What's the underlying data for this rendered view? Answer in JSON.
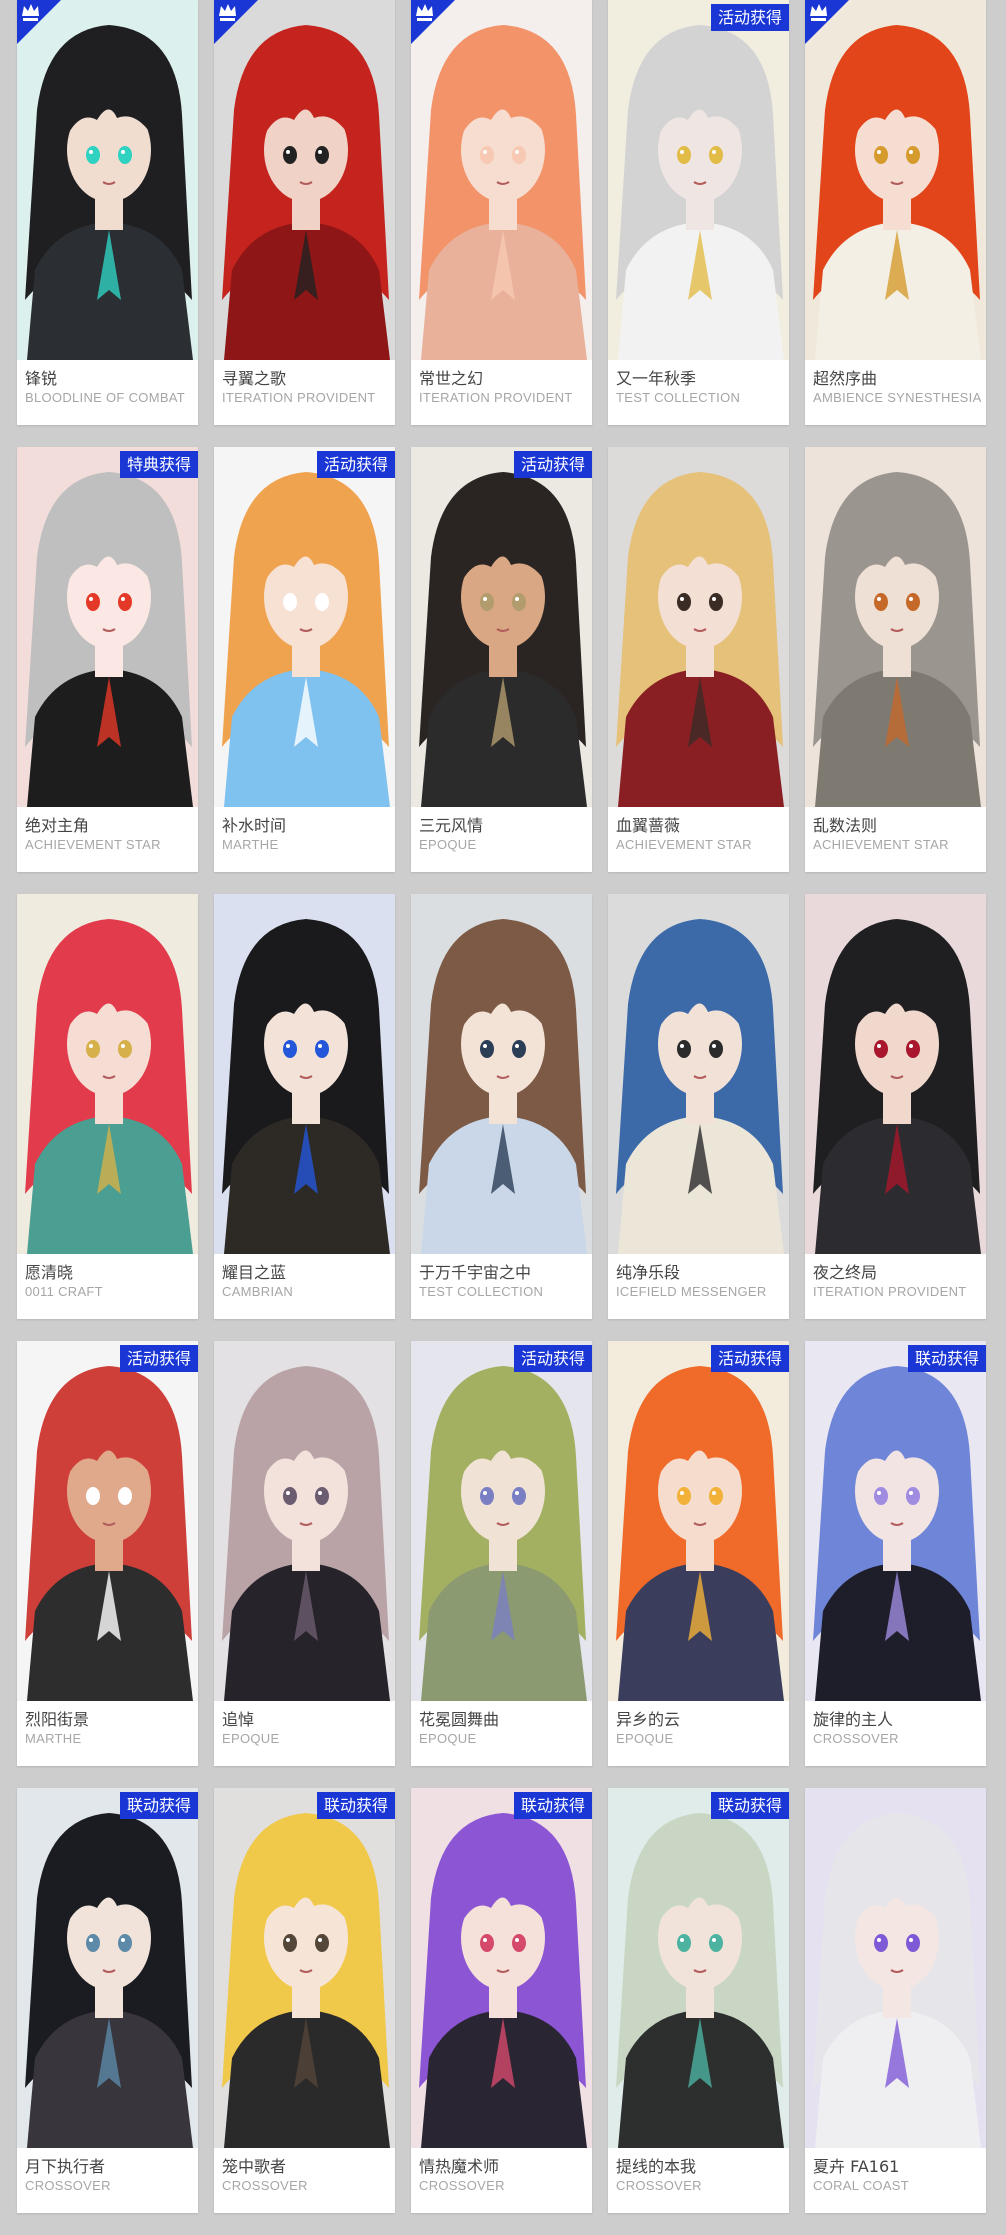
{
  "colors": {
    "badge": "#1a37d6",
    "background": "#cdcdcd",
    "card": "#ffffff"
  },
  "cards": [
    {
      "name": "锋锐",
      "series": "BLOODLINE OF COMBAT",
      "badge": "",
      "crown": true,
      "hair": "#1f1f22",
      "skin": "#f1ddd0",
      "outfit": "#2b2f33",
      "accent": "#2fd2c0"
    },
    {
      "name": "寻翼之歌",
      "series": "ITERATION PROVIDENT",
      "badge": "",
      "crown": true,
      "hair": "#c4231e",
      "skin": "#f0d3c6",
      "outfit": "#8e1616",
      "accent": "#222"
    },
    {
      "name": "常世之幻",
      "series": "ITERATION PROVIDENT",
      "badge": "",
      "crown": true,
      "hair": "#f2936a",
      "skin": "#f6ddcf",
      "outfit": "#e9b09a",
      "accent": "#f7c9b2"
    },
    {
      "name": "又一年秋季",
      "series": "TEST COLLECTION",
      "badge": "活动获得",
      "crown": false,
      "hair": "#d3d3d3",
      "skin": "#efe6e3",
      "outfit": "#f2f2f2",
      "accent": "#e2bc47"
    },
    {
      "name": "超然序曲",
      "series": "AMBIENCE SYNESTHESIA",
      "badge": "",
      "crown": true,
      "hair": "#e2451a",
      "skin": "#f6ddd2",
      "outfit": "#f3efe4",
      "accent": "#d59b2c"
    },
    {
      "name": "绝对主角",
      "series": "ACHIEVEMENT STAR",
      "badge": "特典获得",
      "crown": false,
      "hair": "#bfbfbf",
      "skin": "#fbe7e3",
      "outfit": "#1d1d1d",
      "accent": "#e53928"
    },
    {
      "name": "补水时间",
      "series": "MARTHE",
      "badge": "活动获得",
      "crown": false,
      "hair": "#f0a34f",
      "skin": "#f6e1d2",
      "outfit": "#7fc1ef",
      "accent": "#ffffff"
    },
    {
      "name": "三元风情",
      "series": "EPOQUE",
      "badge": "活动获得",
      "crown": false,
      "hair": "#2a2522",
      "skin": "#d9a783",
      "outfit": "#2b2b2b",
      "accent": "#b29c6e"
    },
    {
      "name": "血翼蔷薇",
      "series": "ACHIEVEMENT STAR",
      "badge": "",
      "crown": false,
      "hair": "#e5c17a",
      "skin": "#f4dfd4",
      "outfit": "#8a1f23",
      "accent": "#3a2b25"
    },
    {
      "name": "乱数法则",
      "series": "ACHIEVEMENT STAR",
      "badge": "",
      "crown": false,
      "hair": "#9a958f",
      "skin": "#efe0d5",
      "outfit": "#7e7a72",
      "accent": "#c4692a"
    },
    {
      "name": "愿清晓",
      "series": "0011 CRAFT",
      "badge": "",
      "crown": false,
      "hair": "#e23c4c",
      "skin": "#f5ddd3",
      "outfit": "#4a9e92",
      "accent": "#d6b04a"
    },
    {
      "name": "耀目之蓝",
      "series": "CAMBRIAN",
      "badge": "",
      "crown": false,
      "hair": "#1a1a1d",
      "skin": "#f2e2d8",
      "outfit": "#2d2a26",
      "accent": "#2356d9"
    },
    {
      "name": "于万千宇宙之中",
      "series": "TEST COLLECTION",
      "badge": "",
      "crown": false,
      "hair": "#7c5a45",
      "skin": "#f3e2d6",
      "outfit": "#c9d7e8",
      "accent": "#2c3e56"
    },
    {
      "name": "纯净乐段",
      "series": "ICEFIELD MESSENGER",
      "badge": "",
      "crown": false,
      "hair": "#3c6aa8",
      "skin": "#f1e1d7",
      "outfit": "#ece6d9",
      "accent": "#2b2b2b"
    },
    {
      "name": "夜之终局",
      "series": "ITERATION PROVIDENT",
      "badge": "",
      "crown": false,
      "hair": "#1f1f22",
      "skin": "#f0d8cd",
      "outfit": "#2c2c30",
      "accent": "#a8172b"
    },
    {
      "name": "烈阳街景",
      "series": "MARTHE",
      "badge": "活动获得",
      "crown": false,
      "hair": "#cf3f3a",
      "skin": "#e0a98b",
      "outfit": "#2d2d2d",
      "accent": "#ffffff"
    },
    {
      "name": "追悼",
      "series": "EPOQUE",
      "badge": "",
      "crown": false,
      "hair": "#b9a3a6",
      "skin": "#f3e1dc",
      "outfit": "#26232a",
      "accent": "#6b5d6f"
    },
    {
      "name": "花冕圆舞曲",
      "series": "EPOQUE",
      "badge": "活动获得",
      "crown": false,
      "hair": "#a3b062",
      "skin": "#f1e2d6",
      "outfit": "#8b9a70",
      "accent": "#7a7fc4"
    },
    {
      "name": "异乡的云",
      "series": "EPOQUE",
      "badge": "活动获得",
      "crown": false,
      "hair": "#f06a2a",
      "skin": "#f5dccd",
      "outfit": "#3a3d5c",
      "accent": "#f2b23a"
    },
    {
      "name": "旋律的主人",
      "series": "CROSSOVER",
      "badge": "联动获得",
      "crown": false,
      "hair": "#6f86d8",
      "skin": "#f2e4e3",
      "outfit": "#1e1e2a",
      "accent": "#9f8be0"
    },
    {
      "name": "月下执行者",
      "series": "CROSSOVER",
      "badge": "联动获得",
      "crown": false,
      "hair": "#1a1c22",
      "skin": "#f2e3da",
      "outfit": "#38353c",
      "accent": "#5c8aa8"
    },
    {
      "name": "笼中歌者",
      "series": "CROSSOVER",
      "badge": "联动获得",
      "crown": false,
      "hair": "#f0c84a",
      "skin": "#f6e5d6",
      "outfit": "#2a2a2a",
      "accent": "#55463a"
    },
    {
      "name": "情热魔术师",
      "series": "CROSSOVER",
      "badge": "联动获得",
      "crown": false,
      "hair": "#8b55d3",
      "skin": "#f5e0da",
      "outfit": "#2a2533",
      "accent": "#d54a6a"
    },
    {
      "name": "提线的本我",
      "series": "CROSSOVER",
      "badge": "联动获得",
      "crown": false,
      "hair": "#c9d6c4",
      "skin": "#f1e3da",
      "outfit": "#2d2f2e",
      "accent": "#4bb3a0"
    },
    {
      "name": "夏卉 FA161",
      "series": "CORAL COAST",
      "badge": "",
      "crown": false,
      "hair": "#e6e6ea",
      "skin": "#f4e6e3",
      "outfit": "#efeff2",
      "accent": "#7f5ad6"
    }
  ]
}
